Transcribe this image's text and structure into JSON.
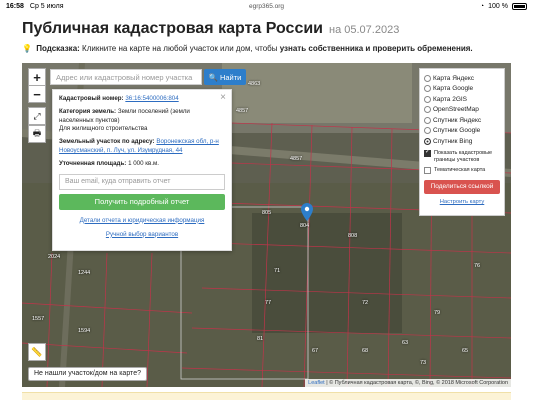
{
  "status_bar": {
    "time": "16:58",
    "date": "Ср 5 июля",
    "url": "egrp365.org",
    "battery": "100 %"
  },
  "header": {
    "title": "Публичная кадастровая карта России",
    "date": "на 05.07.2023"
  },
  "hint": {
    "label": "Подсказка:",
    "text": "Кликните на карте на любой участок или дом, чтобы",
    "bold": "узнать собственника и проверить обременения."
  },
  "search": {
    "placeholder": "Адрес или кадастровый номер участка",
    "button": "Найти"
  },
  "popup": {
    "cadastral_label": "Кадастровый номер:",
    "cadastral_value": "36:16:5400006:804",
    "category_label": "Категория земель:",
    "category_value": "Земли поселений (земли населенных пунктов)",
    "use_value": "Для жилищного строительства",
    "address_label": "Земельный участок по адресу:",
    "address_value": "Воронежская обл, р-н Новоусманский, п. Луч, ул. Изумрудная, 44",
    "area_label": "Уточненная площадь:",
    "area_value": "1 000 кв.м.",
    "email_placeholder": "Ваш email, куда отправить отчет",
    "report_button": "Получить подробный отчет",
    "details_link": "Детали отчета и юридическая информация",
    "manual_link": "Ручной выбор вариантов"
  },
  "layers": {
    "items": [
      {
        "label": "Карта Яндекс",
        "selected": false
      },
      {
        "label": "Карта Google",
        "selected": false
      },
      {
        "label": "Карта 2GIS",
        "selected": false
      },
      {
        "label": "OpenStreetMap",
        "selected": false
      },
      {
        "label": "Спутник Яндекс",
        "selected": false
      },
      {
        "label": "Спутник Google",
        "selected": false
      },
      {
        "label": "Спутник Bing",
        "selected": true
      }
    ],
    "show_borders": "Показать кадастровые границы участков",
    "thematic": "Тематическая карта",
    "share_button": "Поделиться ссылкой",
    "setup_link": "Настроить карту"
  },
  "map": {
    "parcels": [
      "4857",
      "4857",
      "805",
      "804",
      "808",
      "2024",
      "1244",
      "71",
      "77",
      "72",
      "79",
      "76",
      "1557",
      "1594",
      "81",
      "67",
      "68",
      "63",
      "73",
      "65",
      "4863"
    ],
    "not_found": "Не нашли участок/дом на карте?",
    "attribution_leaflet": "Leaflet",
    "attribution_text": "| © Публичная кадастровая карта, ©, Bing, © 2018 Microsoft Corporation",
    "colors": {
      "boundary": "#c0344a",
      "search": "#2d7ecb",
      "report": "#5cb85c",
      "share": "#d9534f",
      "marker": "#2d7ecb"
    }
  }
}
